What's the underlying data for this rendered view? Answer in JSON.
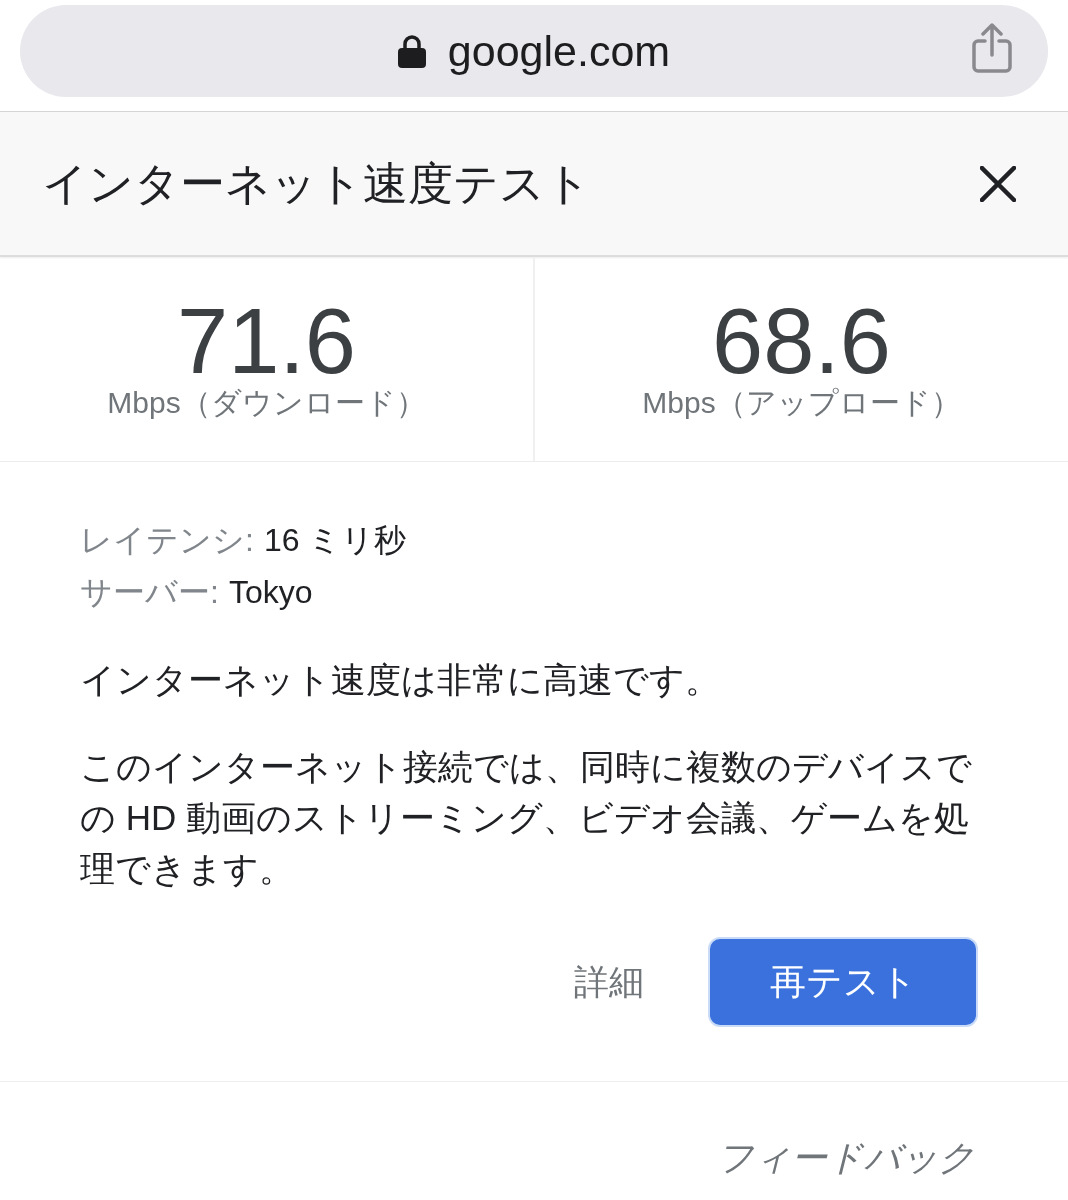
{
  "address_bar": {
    "url": "google.com"
  },
  "panel": {
    "title": "インターネット速度テスト"
  },
  "results": [
    {
      "value": "71.6",
      "label": "Mbps（ダウンロード）"
    },
    {
      "value": "68.6",
      "label": "Mbps（アップロード）"
    }
  ],
  "details": [
    {
      "label": "レイテンシ:",
      "value": "16 ミリ秒"
    },
    {
      "label": "サーバー:",
      "value": "Tokyo"
    }
  ],
  "summary": "インターネット速度は非常に高速です。",
  "description": "このインターネット接続では、同時に複数のデバイスでの HD 動画のストリーミング、ビデオ会議、ゲームを処理できます。",
  "actions": [
    {
      "kind": "link",
      "label": "詳細"
    },
    {
      "kind": "primary",
      "label": "再テスト"
    }
  ],
  "feedback": "フィードバック"
}
